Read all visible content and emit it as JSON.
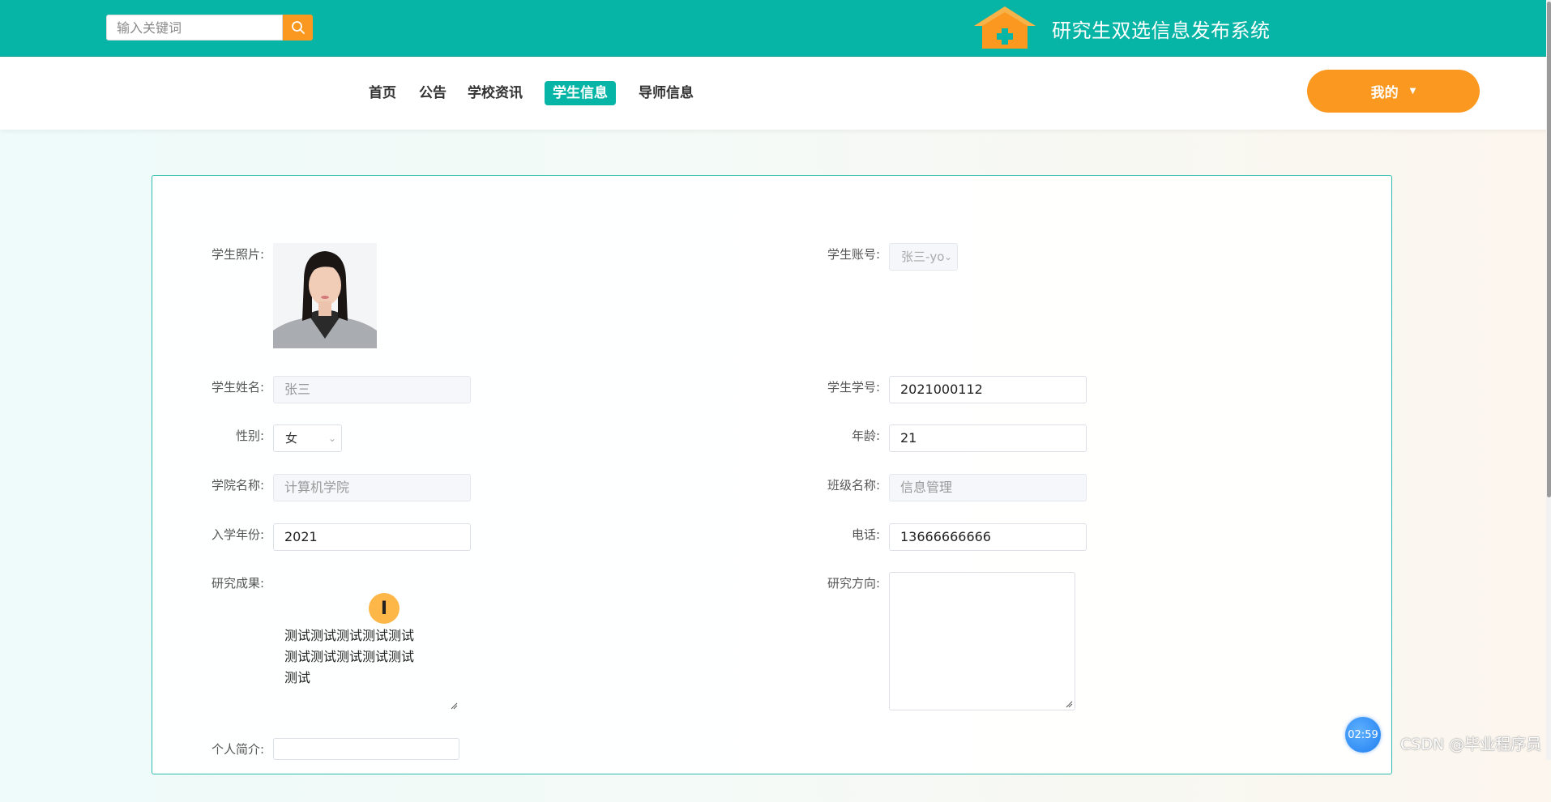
{
  "search": {
    "placeholder": "输入关键词"
  },
  "brand": {
    "title": "研究生双选信息发布系统"
  },
  "nav": {
    "items": [
      {
        "label": "首页",
        "active": false
      },
      {
        "label": "公告",
        "active": false
      },
      {
        "label": "学校资讯",
        "active": false
      },
      {
        "label": "学生信息",
        "active": true
      },
      {
        "label": "导师信息",
        "active": false
      }
    ],
    "user_menu": {
      "label": "我的",
      "caret": "▼"
    }
  },
  "form": {
    "photo_label": "学生照片:",
    "account": {
      "label": "学生账号:",
      "value": "张三-yo"
    },
    "name": {
      "label": "学生姓名:",
      "value": "张三"
    },
    "student_no": {
      "label": "学生学号:",
      "value": "2021000112"
    },
    "gender": {
      "label": "性别:",
      "value": "女"
    },
    "age": {
      "label": "年龄:",
      "value": "21"
    },
    "college": {
      "label": "学院名称:",
      "value": "计算机学院"
    },
    "class": {
      "label": "班级名称:",
      "value": "信息管理"
    },
    "enroll_year": {
      "label": "入学年份:",
      "value": "2021"
    },
    "phone": {
      "label": "电话:",
      "value": "13666666666"
    },
    "research_results": {
      "label": "研究成果:",
      "value": "测试测试测试测试测试\n测试测试测试测试测试\n测试"
    },
    "research_direction": {
      "label": "研究方向:",
      "value": ""
    },
    "intro": {
      "label": "个人简介:",
      "value": ""
    }
  },
  "overlay": {
    "cursor_glyph": "I",
    "timer": "02:59",
    "watermark": "CSDN @毕业程序员"
  },
  "colors": {
    "primary": "#06b5a6",
    "accent": "#fb9820"
  }
}
